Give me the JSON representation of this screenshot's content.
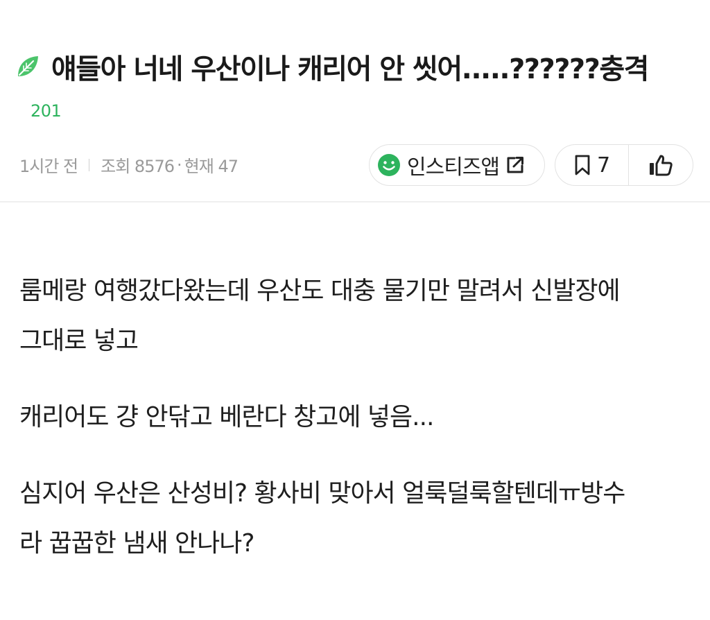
{
  "post": {
    "title": "얘들아 너네 우산이나 캐리어 안 씻어.....??????충격",
    "comment_count": "201",
    "time_ago": "1시간 전",
    "views": "조회 8576",
    "current": "현재 47",
    "dot": "·"
  },
  "actions": {
    "app_label": "인스티즈앱",
    "bookmark_count": "7"
  },
  "content": {
    "p1_line1": "룸메랑 여행갔다왔는데 우산도 대충 물기만 말려서 신발장에",
    "p1_line2": "그대로 넣고",
    "p2": "캐리어도 걍 안닦고 베란다 창고에 넣음...",
    "p3_line1": "심지어 우산은 산성비? 황사비 맞아서 얼룩덜룩할텐데ㅠ방수",
    "p3_line2": "라 꿉꿉한 냄새 안나나?"
  },
  "icons": {
    "leaf": "leaf-icon",
    "smile": "smile-icon",
    "external": "external-link-icon",
    "bookmark": "bookmark-icon",
    "like": "thumbs-up-icon"
  },
  "colors": {
    "accent_green": "#2db35d",
    "meta_gray": "#9a9a9a",
    "border": "#e2e2e2"
  }
}
